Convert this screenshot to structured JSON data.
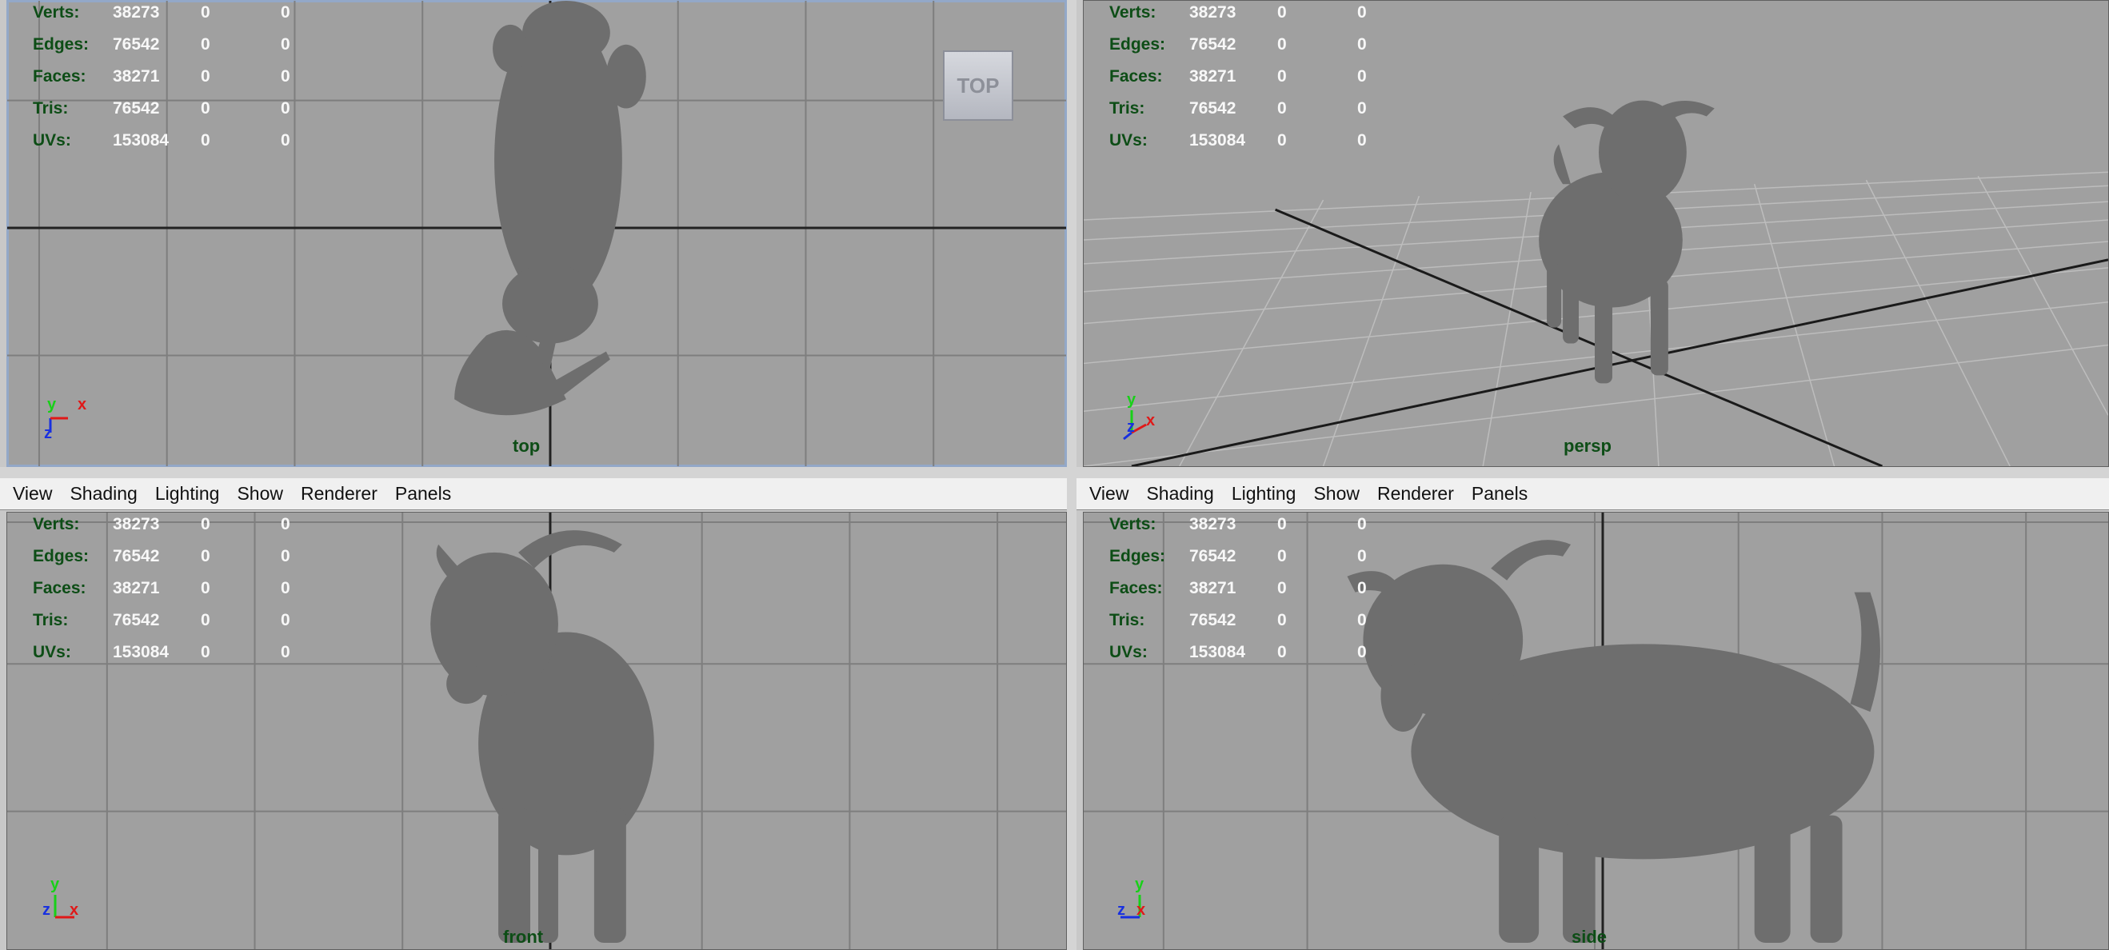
{
  "menu": [
    "View",
    "Shading",
    "Lighting",
    "Show",
    "Renderer",
    "Panels"
  ],
  "hud_rows": [
    {
      "label": "Verts:",
      "v1": "38273",
      "v2": "0",
      "v3": "0"
    },
    {
      "label": "Edges:",
      "v1": "76542",
      "v2": "0",
      "v3": "0"
    },
    {
      "label": "Faces:",
      "v1": "38271",
      "v2": "0",
      "v3": "0"
    },
    {
      "label": "Tris:",
      "v1": "76542",
      "v2": "0",
      "v3": "0"
    },
    {
      "label": "UVs:",
      "v1": "153084",
      "v2": "0",
      "v3": "0"
    }
  ],
  "viewports": {
    "top": {
      "camera": "top",
      "viewcube": "TOP",
      "axes": [
        "y",
        "x",
        "z"
      ]
    },
    "persp": {
      "camera": "persp",
      "axes": [
        "y",
        "x",
        "z"
      ]
    },
    "front": {
      "camera": "front",
      "axes": [
        "y",
        "z",
        "x"
      ]
    },
    "side": {
      "camera": "side",
      "axes": [
        "y",
        "z",
        "x"
      ]
    }
  },
  "colors": {
    "viewport_bg": "#a0a0a0",
    "hud_label": "#0d4d16",
    "hud_value": "#f8f8f8",
    "axis_x": "#e01818",
    "axis_y": "#18d018",
    "axis_z": "#1830e0",
    "model": "#6e6e6e"
  }
}
